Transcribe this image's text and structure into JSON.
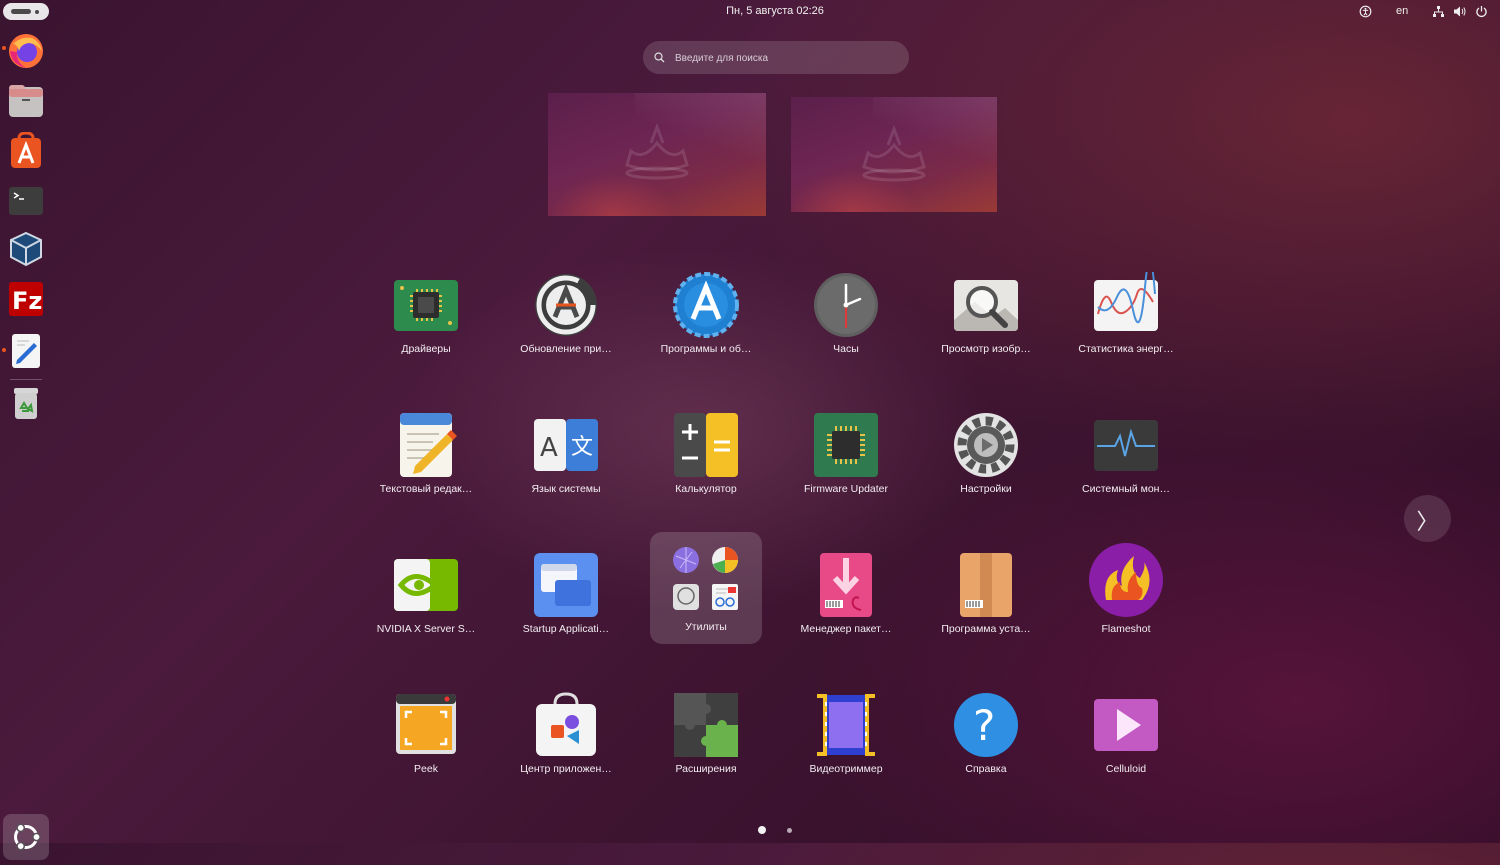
{
  "topbar": {
    "datetime": "Пн, 5 августа  02:26",
    "keyboard_layout": "en",
    "tray_icons": [
      "accessibility-icon",
      "network-icon",
      "volume-icon",
      "power-icon"
    ]
  },
  "dock": {
    "items": [
      {
        "name": "firefox",
        "running": true
      },
      {
        "name": "files",
        "running": false
      },
      {
        "name": "app-center",
        "running": false
      },
      {
        "name": "terminal",
        "running": false
      },
      {
        "name": "virtualbox",
        "running": false
      },
      {
        "name": "filezilla",
        "running": false
      },
      {
        "name": "text-editor",
        "running": true
      },
      {
        "name": "trash",
        "running": false
      }
    ],
    "show_apps_icon": "ubuntu-logo-icon"
  },
  "search": {
    "placeholder": "Введите для поиска"
  },
  "apps": [
    {
      "label": "Драйверы",
      "icon": "chip-icon"
    },
    {
      "label": "Обновление при…",
      "icon": "software-updater-icon"
    },
    {
      "label": "Программы и об…",
      "icon": "software-properties-icon"
    },
    {
      "label": "Часы",
      "icon": "clock-icon"
    },
    {
      "label": "Просмотр изобр…",
      "icon": "image-viewer-icon"
    },
    {
      "label": "Статистика энерг…",
      "icon": "power-statistics-icon"
    },
    {
      "label": "Текстовый редак…",
      "icon": "text-editor-icon"
    },
    {
      "label": "Язык системы",
      "icon": "language-icon"
    },
    {
      "label": "Калькулятор",
      "icon": "calculator-icon"
    },
    {
      "label": "Firmware Updater",
      "icon": "firmware-chip-icon"
    },
    {
      "label": "Настройки",
      "icon": "settings-gear-icon"
    },
    {
      "label": "Системный мон…",
      "icon": "system-monitor-icon"
    },
    {
      "label": "NVIDIA X Server S…",
      "icon": "nvidia-icon"
    },
    {
      "label": "Startup Applicati…",
      "icon": "startup-apps-icon"
    },
    {
      "label": "Утилиты",
      "icon": "folder-utilities-icon"
    },
    {
      "label": "Менеджер пакет…",
      "icon": "package-manager-icon"
    },
    {
      "label": "Программа уста…",
      "icon": "package-installer-icon"
    },
    {
      "label": "Flameshot",
      "icon": "flameshot-icon"
    },
    {
      "label": "Peek",
      "icon": "peek-icon"
    },
    {
      "label": "Центр приложен…",
      "icon": "app-center-icon"
    },
    {
      "label": "Расширения",
      "icon": "extensions-icon"
    },
    {
      "label": "Видеотриммер",
      "icon": "video-trimmer-icon"
    },
    {
      "label": "Справка",
      "icon": "help-icon"
    },
    {
      "label": "Celluloid",
      "icon": "celluloid-icon"
    }
  ],
  "pager": {
    "pages": 2,
    "current": 1
  },
  "colors": {
    "accent": "#e95420",
    "folder_bg": "rgba(255,255,255,0.16)"
  }
}
